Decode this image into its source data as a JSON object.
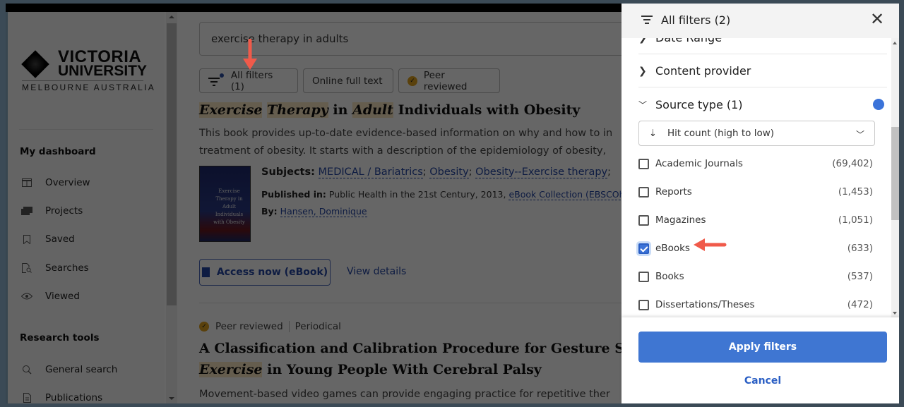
{
  "sidebar": {
    "logo": {
      "line1": "VICTORIA",
      "line2": "UNIVERSITY",
      "line3": "MELBOURNE AUSTRALIA"
    },
    "sections": [
      {
        "heading": "My dashboard",
        "items": [
          {
            "label": "Overview",
            "icon": "columns-icon"
          },
          {
            "label": "Projects",
            "icon": "folders-icon"
          },
          {
            "label": "Saved",
            "icon": "bookmark-icon"
          },
          {
            "label": "Searches",
            "icon": "search-document-icon"
          },
          {
            "label": "Viewed",
            "icon": "eye-icon"
          }
        ]
      },
      {
        "heading": "Research tools",
        "items": [
          {
            "label": "General search",
            "icon": "search-icon"
          },
          {
            "label": "Publications",
            "icon": "document-icon"
          }
        ]
      }
    ]
  },
  "search": {
    "value": "exercise therapy in adults"
  },
  "filter_chips": {
    "all_filters": "All filters (1)",
    "online_full_text": "Online full text",
    "peer_reviewed": "Peer reviewed"
  },
  "results": [
    {
      "title_parts": [
        "Exercise",
        "Therapy",
        "in",
        "Adult",
        "Individuals with Obesity"
      ],
      "description_lines": [
        "This book provides up-to-date evidence-based information on why and how to in",
        "treatment of obesity. It starts with a description of the epidemiology of obesity,"
      ],
      "cover_text": "Exercise Therapy in Adult Individuals with Obesity",
      "subjects_label": "Subjects:",
      "subjects": [
        "MEDICAL / Bariatrics",
        "Obesity",
        "Obesity--Exercise therapy"
      ],
      "published_label": "Published in:",
      "published_text": "Public Health in the 21st Century, 2013,",
      "published_link": "eBook Collection (EBSCOhost)",
      "by_label": "By:",
      "author": "Hansen, Dominique",
      "access_button": "Access now (eBook)",
      "view_details": "View details"
    },
    {
      "peer_reviewed": "Peer reviewed",
      "type": "Periodical",
      "title_line1": "A Classification and Calibration Procedure for Gesture Spec",
      "title_line2_hl": "Exercise",
      "title_line2_rest": "in Young People With Cerebral Palsy",
      "description": "Movement-based video games can provide engaging practice for repetitive ther"
    }
  ],
  "filter_panel": {
    "title": "All filters (2)",
    "sections": [
      {
        "label": "Date Range",
        "expanded": false
      },
      {
        "label": "Content provider",
        "expanded": false
      },
      {
        "label": "Source type (1)",
        "expanded": true,
        "active": true
      }
    ],
    "sort": {
      "selected": "Hit count (high to low)"
    },
    "source_types": [
      {
        "label": "Academic Journals",
        "count": "(69,402)",
        "checked": false
      },
      {
        "label": "Reports",
        "count": "(1,453)",
        "checked": false
      },
      {
        "label": "Magazines",
        "count": "(1,051)",
        "checked": false
      },
      {
        "label": "eBooks",
        "count": "(633)",
        "checked": true
      },
      {
        "label": "Books",
        "count": "(537)",
        "checked": false
      },
      {
        "label": "Dissertations/Theses",
        "count": "(472)",
        "checked": false
      }
    ],
    "apply": "Apply filters",
    "cancel": "Cancel",
    "accent": "#3f76d2"
  }
}
